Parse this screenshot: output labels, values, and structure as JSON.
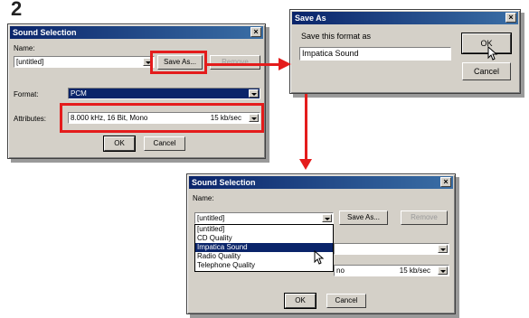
{
  "step_marker": "2",
  "left_dialog": {
    "title": "Sound Selection",
    "name_label": "Name:",
    "name_value": "[untitled]",
    "save_as": "Save As...",
    "remove": "Remove",
    "format_label": "Format:",
    "format_value": "PCM",
    "attributes_label": "Attributes:",
    "attributes_value": "8.000 kHz, 16 Bit, Mono",
    "attributes_rate": "15 kb/sec",
    "ok": "OK",
    "cancel": "Cancel"
  },
  "save_dialog": {
    "title": "Save As",
    "prompt": "Save this format as",
    "value": "Impatica Sound",
    "ok": "OK",
    "cancel": "Cancel"
  },
  "bottom_dialog": {
    "title": "Sound Selection",
    "name_label": "Name:",
    "name_value": "[untitled]",
    "save_as": "Save As...",
    "remove": "Remove",
    "options": [
      "[untitled]",
      "CD Quality",
      "Impatica Sound",
      "Radio Quality",
      "Telephone Quality"
    ],
    "selected_option": "Impatica Sound",
    "attributes_partial": "no",
    "attributes_rate": "15 kb/sec",
    "ok": "OK",
    "cancel": "Cancel"
  },
  "colors": {
    "highlight": "#e41c1c",
    "title_bar": "#0a246a",
    "dialog_bg": "#d4d0c8"
  }
}
